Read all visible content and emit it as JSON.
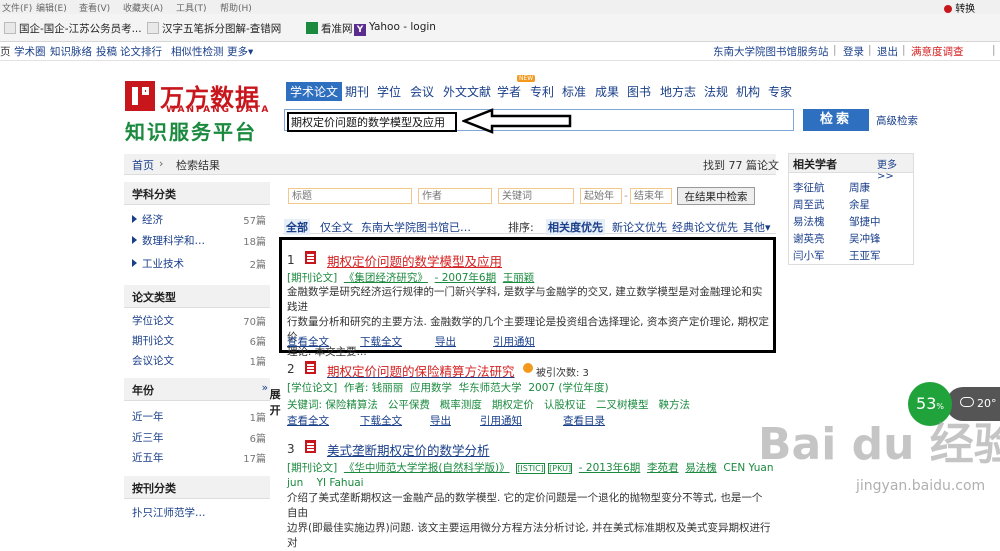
{
  "browser": {
    "menu": [
      "文件(F)",
      "编辑(E)",
      "查看(V)",
      "收藏夹(A)",
      "工具(T)",
      "帮助(H)"
    ],
    "convert_label": "转换",
    "bookmarks": [
      "国企-国企-江苏公务员考...",
      "汉字五笔拆分图解-查错网",
      "看准网",
      "Yahoo - login"
    ]
  },
  "sitenav": {
    "left": [
      "页",
      "学术圈",
      "知识脉络",
      "投稿",
      "论文排行",
      "相似性检测",
      "更多▾"
    ],
    "right": [
      "东南大学院图书馆服务站",
      "|",
      "登录",
      "|",
      "退出",
      "|",
      "满意度调查",
      "|"
    ]
  },
  "logo": {
    "cn": "万方数据",
    "en": "WANFANG DATA",
    "sub": "知识服务平台"
  },
  "search": {
    "tabs": [
      "学术论文",
      "期刊",
      "学位",
      "会议",
      "外文文献",
      "学者",
      "专利",
      "标准",
      "成果",
      "图书",
      "地方志",
      "法规",
      "机构",
      "专家"
    ],
    "new_badge": "NEW",
    "query": "期权定价问题的数学模型及应用",
    "button": "检索",
    "advanced": "高级检索"
  },
  "breadcrumb": {
    "home": "首页",
    "sep": "›",
    "current": "检索结果",
    "found_prefix": "找到",
    "found_count": "77",
    "found_suffix": "篇论文"
  },
  "sidebar": {
    "subject_head": "学科分类",
    "subjects": [
      {
        "label": "经济",
        "count": "57篇"
      },
      {
        "label": "数理科学和…",
        "count": "18篇"
      },
      {
        "label": "工业技术",
        "count": "2篇"
      }
    ],
    "type_head": "论文类型",
    "types": [
      {
        "label": "学位论文",
        "count": "70篇"
      },
      {
        "label": "期刊论文",
        "count": "6篇"
      },
      {
        "label": "会议论文",
        "count": "1篇"
      }
    ],
    "year_head": "年份",
    "year_expand": "展开",
    "years": [
      {
        "label": "近一年",
        "count": "1篇"
      },
      {
        "label": "近三年",
        "count": "6篇"
      },
      {
        "label": "近五年",
        "count": "17篇"
      }
    ],
    "org_head": "按刊分类",
    "org_partial": "扑只江师范学…"
  },
  "filters": {
    "title_ph": "标题",
    "author_ph": "作者",
    "keyword_ph": "关键词",
    "start_ph": "起始年",
    "dash": "-",
    "end_ph": "结束年",
    "button": "在结果中检索"
  },
  "scope": {
    "all": "全部",
    "full": "仅全文",
    "lib": "东南大学院图书馆已…"
  },
  "sort": {
    "label": "排序:",
    "relevance": "相关度优先",
    "newest": "新论文优先",
    "classic": "经典论文优先",
    "other": "其他▾"
  },
  "results": [
    {
      "num": "1",
      "title": "期权定价问题的数学模型及应用",
      "meta": [
        "[期刊论文]",
        "《集团经济研究》",
        "- 2007年6期",
        "王丽颖"
      ],
      "abstract": [
        "金融数学是研究经济运行规律的一门新兴学科, 是数学与金融学的交叉, 建立数学模型是对金融理论和实践进",
        "行数量分析和研究的主要方法. 金融数学的几个主要理论是投资组合选择理论, 资本资产定价理论, 期权定价",
        "理论. 本文主要..."
      ],
      "actions": [
        "查看全文",
        "下载全文",
        "导出",
        "引用通知"
      ]
    },
    {
      "num": "2",
      "title": "期权定价问题的保险精算方法研究",
      "cited": "被引次数: 3",
      "meta": [
        "[学位论文]",
        "作者: 钱丽丽",
        "应用数学",
        "华东师范大学",
        "2007 (学位年度)"
      ],
      "keywords": [
        "关键词: 保险精算法",
        "公平保费",
        "概率测度",
        "期权定价",
        "认股权证",
        "二叉树模型",
        "鞅方法"
      ],
      "actions": [
        "查看全文",
        "下载全文",
        "导出",
        "引用通知",
        "查看目录"
      ]
    },
    {
      "num": "3",
      "title": "美式垄断期权定价的数学分析",
      "meta": [
        "[期刊论文]",
        "《华中师范大学学报(自然科学版)》",
        "[ISTIC]",
        "[PKU]",
        "- 2013年6期",
        "李苑君",
        "易法槐",
        "CEN Yuan"
      ],
      "meta2": "jun    YI Fahuai",
      "abstract": [
        "介绍了美式垄断期权这一金融产品的数学模型. 它的定价问题是一个退化的抛物型变分不等式, 也是一个自由",
        "边界(即最佳实施边界)问题. 该文主要运用微分方程方法分析讨论, 并在美式标准期权及美式变异期权进行对"
      ]
    }
  ],
  "related": {
    "head": "相关学者",
    "more": "更多>>",
    "scholars": [
      "李征航",
      "周康",
      "周至武",
      "余星",
      "易法槐",
      "邹捷中",
      "谢英亮",
      "吴冲锋",
      "闫小军",
      "王亚军"
    ]
  },
  "overlay": {
    "percent": "53",
    "percent_unit": "%",
    "temp": "20°",
    "watermark": "Bai du 经验",
    "watermark_url": "jingyan.baidu.com"
  }
}
